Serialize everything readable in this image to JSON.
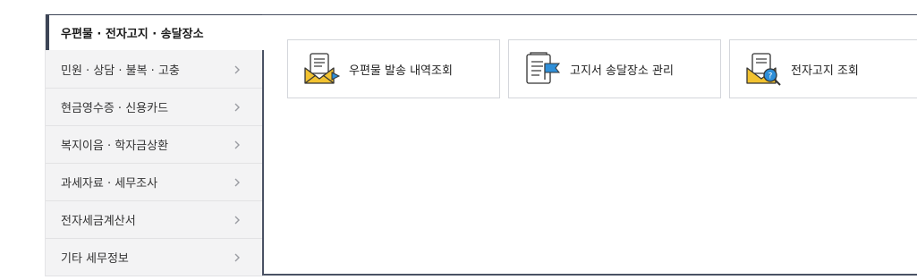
{
  "sidebar": {
    "active_label": "우편물 · 전자고지 · 송달장소",
    "items": [
      {
        "label": "민원 · 상담 · 불복 · 고충"
      },
      {
        "label": "현금영수증 · 신용카드"
      },
      {
        "label": "복지이음 · 학자금상환"
      },
      {
        "label": "과세자료 · 세무조사"
      },
      {
        "label": "전자세금계산서"
      },
      {
        "label": "기타 세무정보"
      }
    ],
    "chevron": "›"
  },
  "main": {
    "cards": [
      {
        "label": "우편물 발송 내역조회",
        "icon": "mail-envelope-icon"
      },
      {
        "label": "고지서 송달장소 관리",
        "icon": "document-flag-icon"
      },
      {
        "label": "전자고지 조회",
        "icon": "mail-search-icon"
      }
    ]
  },
  "colors": {
    "accent_navy": "#3d4556",
    "icon_blue": "#2f8fd8",
    "icon_yellow": "#f2c230",
    "sidebar_bg": "#f3f3f4"
  }
}
